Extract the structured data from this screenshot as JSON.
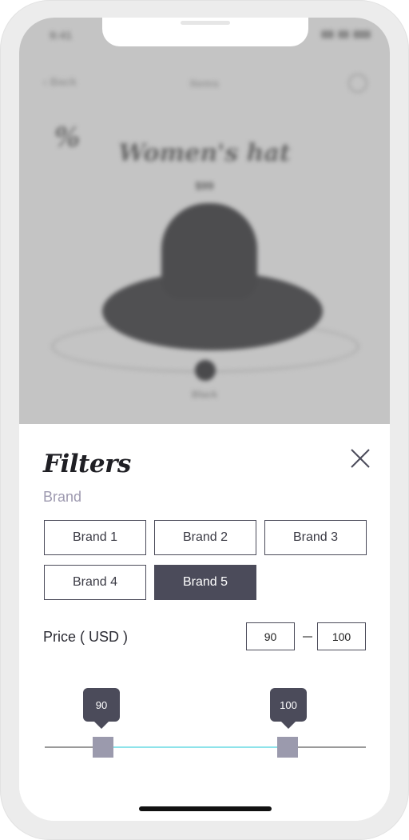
{
  "status_bar": {
    "time": "9:41"
  },
  "top_nav": {
    "back_label": "Back",
    "title": "Items"
  },
  "product": {
    "logo": "%",
    "title": "Women's hat",
    "price": "$99",
    "color_label": "Black"
  },
  "filters": {
    "title": "Filters",
    "brand_section": {
      "label": "Brand",
      "options": [
        {
          "label": "Brand 1",
          "selected": false
        },
        {
          "label": "Brand 2",
          "selected": false
        },
        {
          "label": "Brand 3",
          "selected": false
        },
        {
          "label": "Brand 4",
          "selected": false
        },
        {
          "label": "Brand 5",
          "selected": true
        }
      ]
    },
    "price_section": {
      "label": "Price ( USD )",
      "min": "90",
      "max": "100",
      "slider_low": "90",
      "slider_high": "100"
    }
  },
  "colors": {
    "accent": "#4b4b5a",
    "slider_range": "#8ee3ea",
    "handle": "#9b9aad",
    "section_label": "#9e9ab0"
  },
  "icons": {
    "close": "close-icon",
    "search": "search-icon",
    "back": "chevron-left-icon"
  }
}
